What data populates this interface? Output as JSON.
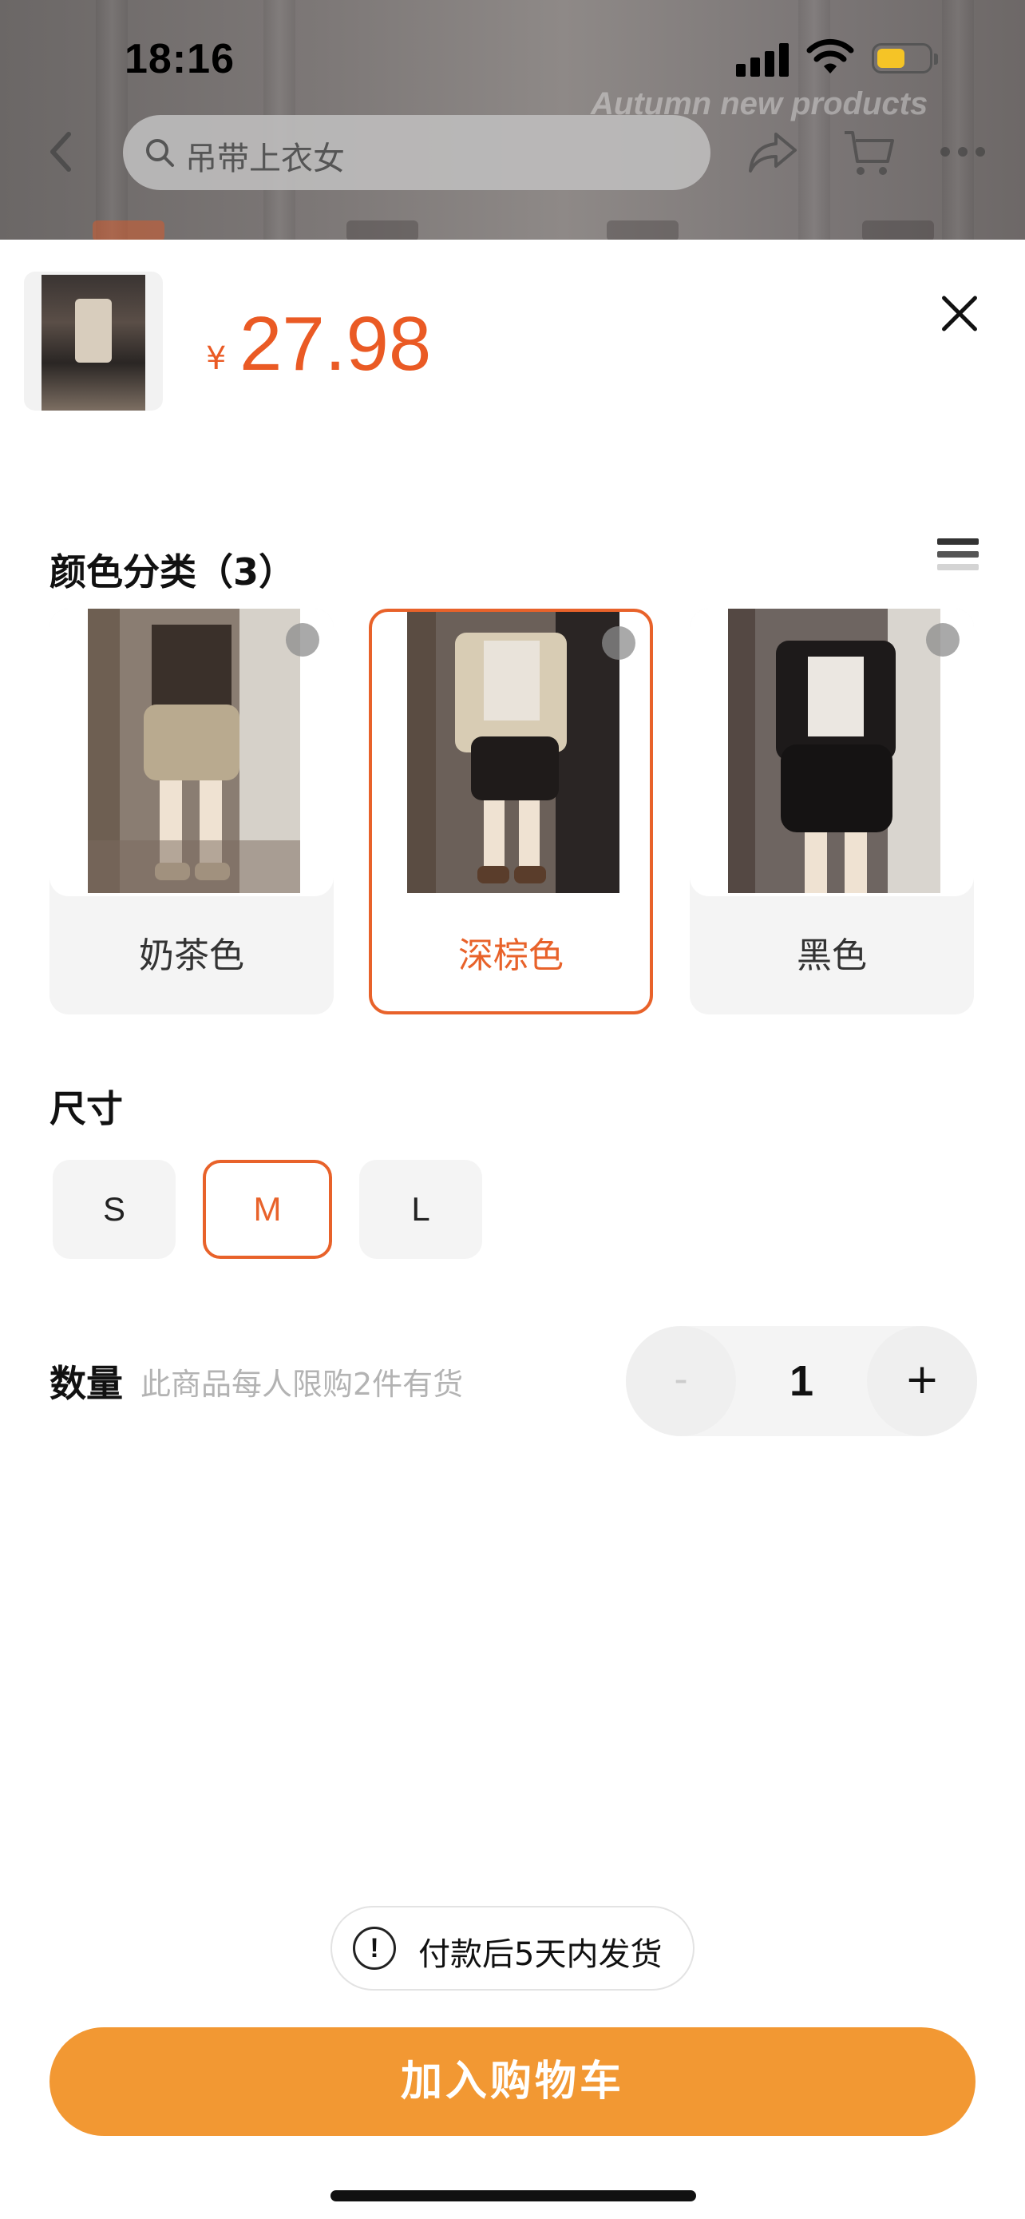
{
  "status_bar": {
    "time": "18:16"
  },
  "background_page": {
    "search_placeholder": "吊带上衣女",
    "watermark": "Autumn new products"
  },
  "sheet": {
    "price_currency": "¥",
    "price": "27.98",
    "color_section": {
      "title": "颜色分类（3）",
      "options": [
        {
          "label": "奶茶色",
          "selected": false
        },
        {
          "label": "深棕色",
          "selected": true
        },
        {
          "label": "黑色",
          "selected": false
        }
      ]
    },
    "size_section": {
      "title": "尺寸",
      "options": [
        {
          "label": "S",
          "selected": false
        },
        {
          "label": "M",
          "selected": true
        },
        {
          "label": "L",
          "selected": false
        }
      ]
    },
    "quantity": {
      "label": "数量",
      "note": "此商品每人限购2件有货",
      "minus": "-",
      "value": "1",
      "plus": "+"
    },
    "shipping_note": "付款后5天内发货",
    "info_icon_glyph": "!",
    "add_to_cart": "加入购物车"
  },
  "colors": {
    "accent": "#e8622a",
    "price": "#ea5a24",
    "button": "#f29833",
    "chip_bg": "#f4f4f4"
  },
  "icons": [
    "back-arrow-icon",
    "search-icon",
    "share-icon",
    "cart-icon",
    "more-icon",
    "close-icon",
    "list-view-icon",
    "expand-icon",
    "info-icon"
  ]
}
